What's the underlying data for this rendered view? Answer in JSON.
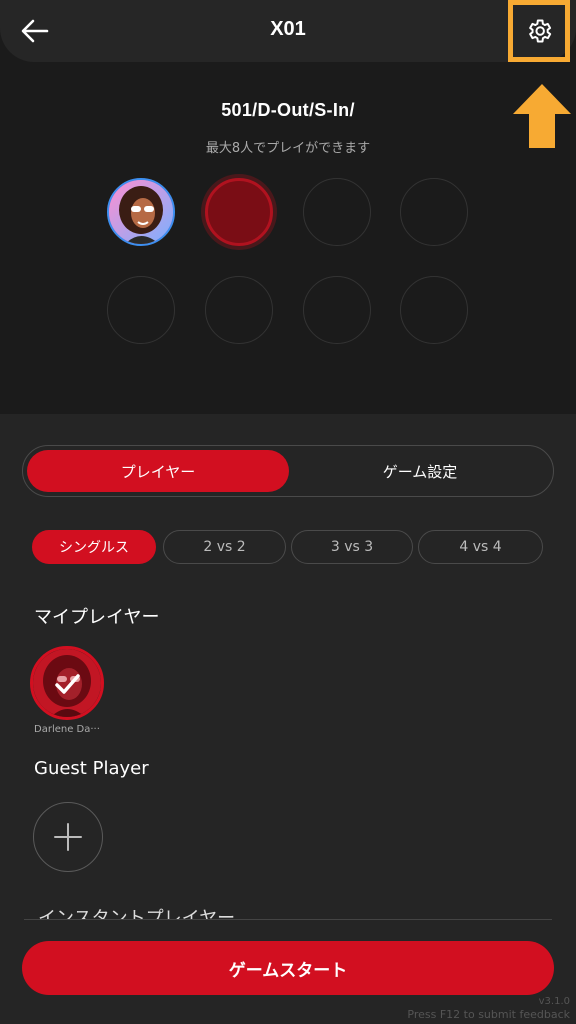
{
  "header": {
    "title": "X01"
  },
  "game": {
    "rule": "501/D-Out/S-In/",
    "subtitle": "最大8人でプレイができます"
  },
  "tabs": {
    "player": "プレイヤー",
    "settings": "ゲーム設定"
  },
  "modes": [
    "シングルス",
    "2 vs 2",
    "3 vs 3",
    "4 vs 4"
  ],
  "my_players": {
    "title": "マイプレイヤー",
    "name": "Darlene Da···"
  },
  "guest": {
    "title": "Guest Player"
  },
  "instant": {
    "title": "インスタントプレイヤー"
  },
  "start_button": "ゲームスタート",
  "footer": {
    "version": "v3.1.0",
    "feedback": "Press F12 to submit feedback"
  },
  "colors": {
    "accent": "#d20f20",
    "highlight": "#f7aa33",
    "avatar_ring": "#3d8ff0"
  }
}
